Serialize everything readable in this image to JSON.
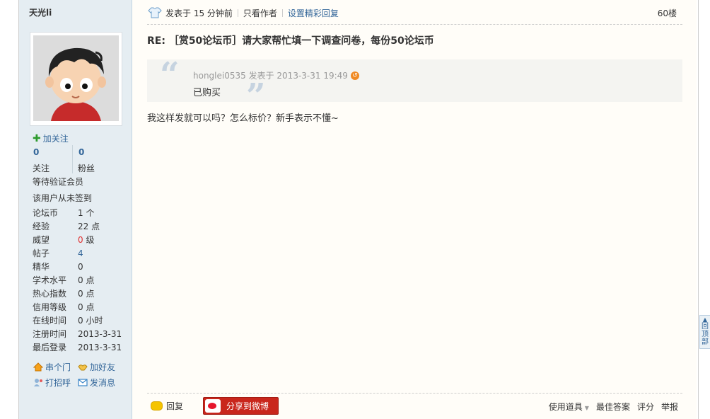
{
  "user": {
    "name": "天光li",
    "follow_label": "加关注",
    "following_count": "0",
    "followers_count": "0",
    "following_label": "关注",
    "followers_label": "粉丝",
    "group": "等待验证会员",
    "checkin": "该用户从未签到",
    "profile": [
      {
        "key": "论坛币",
        "value": "1 个"
      },
      {
        "key": "经验",
        "value": "22 点"
      },
      {
        "key": "威望",
        "value_num": "0",
        "value_unit": " 级"
      },
      {
        "key": "帖子",
        "value": "4"
      },
      {
        "key": "精华",
        "value": "0"
      },
      {
        "key": "学术水平",
        "value": "0 点"
      },
      {
        "key": "热心指数",
        "value": "0 点"
      },
      {
        "key": "信用等级",
        "value": "0 点"
      },
      {
        "key": "在线时间",
        "value": "0 小时"
      },
      {
        "key": "注册时间",
        "value": "2013-3-31"
      },
      {
        "key": "最后登录",
        "value": "2013-3-31"
      }
    ],
    "actions": {
      "visit": "串个门",
      "add_friend": "加好友",
      "greet": "打招呼",
      "message": "发消息"
    }
  },
  "post": {
    "posted_time": "发表于 15 分钟前",
    "only_author": "只看作者",
    "set_highlight": "设置精彩回复",
    "floor": "60楼",
    "title": "RE: ［赏50论坛币］请大家帮忙填一下调查问卷，每份50论坛币",
    "quote": {
      "author": "honglei0535",
      "time": "发表于 2013-3-31 19:49",
      "text": "已购买"
    },
    "body": "我这样发就可以吗？怎么标价？新手表示不懂~"
  },
  "footer": {
    "reply": "回复",
    "share_weibo": "分享到微博",
    "use_tool": "使用道具",
    "best_answer": "最佳答案",
    "rate": "评分",
    "report": "举报"
  },
  "back_to_top": "回顶部",
  "colors": {
    "sidebar_bg": "#e5edf2",
    "post_bg": "#fffdf8",
    "link_blue": "#336699",
    "prestige_red": "#e03030",
    "weibo_red": "#c9261c"
  }
}
